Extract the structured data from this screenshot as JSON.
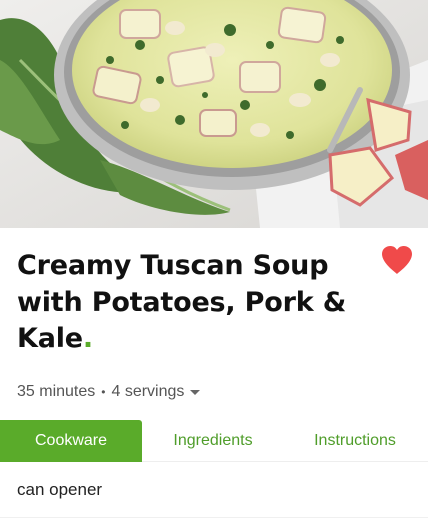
{
  "recipe": {
    "title_main": "Creamy Tuscan Soup with Potatoes, Pork & Kale",
    "title_dot": ".",
    "time": "35 minutes",
    "separator": "•",
    "servings": "4 servings",
    "favorite_icon": "heart-icon",
    "favorite_color": "#f04a4a"
  },
  "tabs": [
    {
      "label": "Cookware",
      "active": true
    },
    {
      "label": "Ingredients",
      "active": false
    },
    {
      "label": "Instructions",
      "active": false
    }
  ],
  "cookware": [
    "can opener"
  ],
  "colors": {
    "accent": "#5aab2a",
    "tab_text": "#4f9d2a"
  }
}
